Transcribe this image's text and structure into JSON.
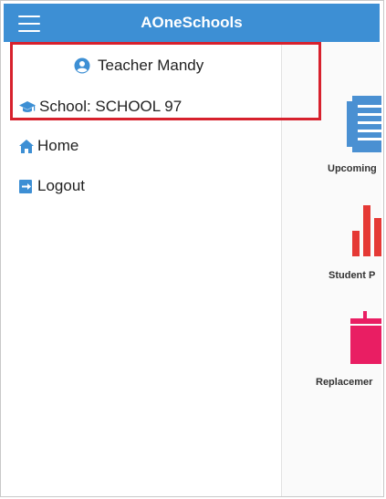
{
  "header": {
    "title": "AOneSchools",
    "menu_icon": "hamburger-menu-icon",
    "background_color": "#3d8fd4"
  },
  "drawer": {
    "user": {
      "name": "Teacher Mandy",
      "icon": "user-avatar-icon"
    },
    "school": {
      "label": "School: SCHOOL 97",
      "icon": "graduation-cap-icon"
    },
    "items": [
      {
        "label": "Home",
        "icon": "home-icon"
      },
      {
        "label": "Logout",
        "icon": "logout-icon"
      }
    ],
    "highlight_color": "#d7212d"
  },
  "dashboard": {
    "tiles": [
      {
        "label": "Upcoming",
        "icon": "document-list-icon",
        "color": "#4a90d2"
      },
      {
        "label": "Student P",
        "icon": "bar-chart-icon",
        "color": "#e53935"
      },
      {
        "label": "Replacemer",
        "icon": "calendar-icon",
        "color": "#e91e63"
      }
    ]
  }
}
